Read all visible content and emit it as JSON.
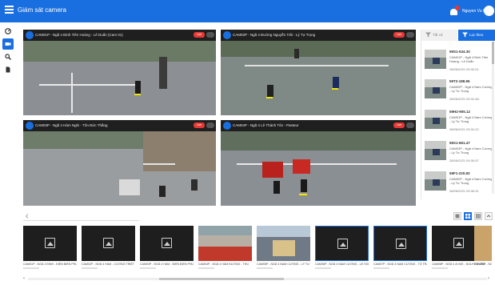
{
  "app": {
    "title": "Giám sát camera",
    "user_name": "Nguyen Vu Hai"
  },
  "videos": [
    {
      "title": "CAM01P - Ngã 4 Đinh Tiên Hoàng - Lê Duẩn (Cam 01)",
      "live": "Live"
    },
    {
      "title": "CAM02P - Ngã 4 Đường Nguyễn Trãi - Lý Tự Trọng",
      "live": "Live"
    },
    {
      "title": "CAM03P - Ngã 4 Hàm Nghi - Tôn Đức Thắng",
      "live": "Live"
    },
    {
      "title": "CAM04P - Ngã 4 Lê Thánh Tôn - Pasteur",
      "live": "Live"
    }
  ],
  "filters": {
    "left": "Tất cả",
    "right": "Lọc theo"
  },
  "events": [
    {
      "plate": "59S1-534.30",
      "location": "CAM01P - Ngã 4 Đinh Tiên Hoàng - Lê Duẩn",
      "time": "28/06/2021 09:32:01"
    },
    {
      "plate": "59T2-188.95",
      "location": "CAM02P - Ngã 4 Nam Cường - Lý Tự Trọng",
      "time": "28/06/2021 09:31:48"
    },
    {
      "plate": "59H2-905.12",
      "location": "CAM01P - Ngã 4 Nam Cường - Lý Tự Trọng",
      "time": "28/06/2021 09:31:22"
    },
    {
      "plate": "59X1-661.47",
      "location": "CAM03P - Ngã 4 Nam Cường - Lý Tự Trọng",
      "time": "28/06/2021 09:30:57"
    },
    {
      "plate": "59F1-220.83",
      "location": "CAM02P - Ngã 4 Nam Cường - Lý Tự Trọng",
      "time": "28/06/2021 09:30:31"
    }
  ],
  "search": {
    "placeholder": ""
  },
  "camera_list": [
    {
      "label": "CAM01P - NGÃ 4 ĐINH - ĐIỆN BIÊN PHỦ",
      "kind": "placeholder"
    },
    {
      "label": "CAM02P - NGÃ 4 HÀM - CƯỜNG TRIỆT",
      "kind": "placeholder"
    },
    {
      "label": "CAM03P - NGÃ 4 HÀM - ĐIỆN BIÊN PHỦ",
      "kind": "placeholder"
    },
    {
      "label": "CAM04P - NGÃ 4 HÀM ĐƯỜNG - THỦ",
      "kind": "image"
    },
    {
      "label": "CAM05P - NGÃ 4 NAM CƯỜNG - LÝ TỰ",
      "kind": "image"
    },
    {
      "label": "CAM06P - NGÃ 4 NAM CƯỜNG - LÊ HỒNG",
      "kind": "placeholder"
    },
    {
      "label": "CAM07P - NGÃ 4 NAM CƯỜNG - TÔ TRẦN",
      "kind": "placeholder"
    },
    {
      "label": "CAM08P - NGÃ 4 ÁI MỘ - NGUYỄN VĂN",
      "kind": "placeholder"
    },
    {
      "label": "CAM09P - NGÃ 4",
      "kind": "image"
    }
  ],
  "colors": {
    "primary": "#1a6fe0",
    "live": "#e53935",
    "video_bg": "#262626"
  }
}
